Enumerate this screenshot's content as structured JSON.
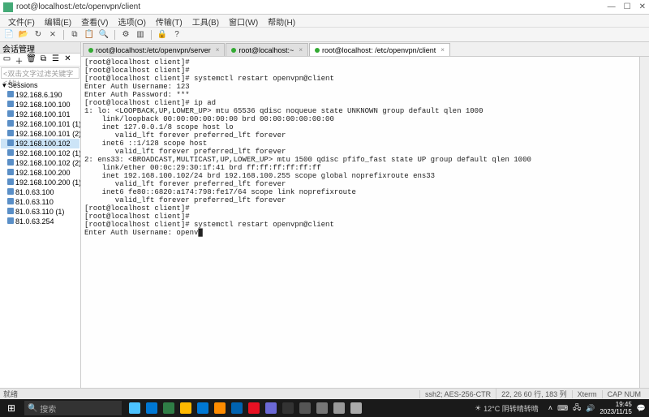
{
  "titlebar": {
    "title": "root@localhost:/etc/openvpn/client"
  },
  "menubar": {
    "items": [
      "文件(F)",
      "编辑(E)",
      "查看(V)",
      "选项(O)",
      "传输(T)",
      "工具(B)",
      "窗口(W)",
      "帮助(H)"
    ]
  },
  "sidebar": {
    "head": "会话管理",
    "filter": "<双击文字过滤关键字<Alt+",
    "rootLabel": "Sessions",
    "items": [
      "192.168.6.190",
      "192.168.100.100",
      "192.168.100.101",
      "192.168.100.101 (1)",
      "192.168.100.101 (2)",
      "192.168.100.102",
      "192.168.100.102 (1)",
      "192.168.100.102 (2)",
      "192.168.100.200",
      "192.168.100.200 (1)",
      "81.0.63.100",
      "81.0.63.110",
      "81.0.63.110 (1)",
      "81.0.63.254"
    ],
    "selectedIndex": 5
  },
  "tabs": {
    "items": [
      {
        "label": "root@localhost:/etc/openvpn/server",
        "active": false
      },
      {
        "label": "root@localhost:~",
        "active": false
      },
      {
        "label": "root@localhost: /etc/openvpn/client",
        "active": true
      }
    ]
  },
  "terminal": {
    "lines": [
      "[root@localhost client]#",
      "[root@localhost client]#",
      "[root@localhost client]# systemctl restart openvpn@client",
      "Enter Auth Username: 123",
      "Enter Auth Password: ***",
      "[root@localhost client]# ip ad",
      "1: lo: <LOOPBACK,UP,LOWER_UP> mtu 65536 qdisc noqueue state UNKNOWN group default qlen 1000",
      "    link/loopback 00:00:00:00:00:00 brd 00:00:00:00:00:00",
      "    inet 127.0.0.1/8 scope host lo",
      "       valid_lft forever preferred_lft forever",
      "    inet6 ::1/128 scope host",
      "       valid_lft forever preferred_lft forever",
      "2: ens33: <BROADCAST,MULTICAST,UP,LOWER_UP> mtu 1500 qdisc pfifo_fast state UP group default qlen 1000",
      "    link/ether 00:0c:29:30:1f:41 brd ff:ff:ff:ff:ff:ff",
      "    inet 192.168.100.102/24 brd 192.168.100.255 scope global noprefixroute ens33",
      "       valid_lft forever preferred_lft forever",
      "    inet6 fe80::6820:a174:798:fe17/64 scope link noprefixroute",
      "       valid_lft forever preferred_lft forever",
      "[root@localhost client]#",
      "[root@localhost client]#",
      "[root@localhost client]# systemctl restart openvpn@client",
      "Enter Auth Username: openv█"
    ]
  },
  "statusbar": {
    "left": "就绪",
    "enc": "ssh2; AES-256-CTR",
    "pos": "22, 26  60 行, 183 列",
    "mode": "Xterm",
    "caps": "CAP  NUM"
  },
  "taskbar": {
    "search": "搜索",
    "weather": "12°C  阴转晴转晴",
    "time": "19:45",
    "date": "2023/11/15",
    "appColors": [
      "#4cc2ff",
      "#0078d4",
      "#2f7d46",
      "#ffb900",
      "#0078d4",
      "#ff8c00",
      "#0063b1",
      "#e81123",
      "#6b69d6",
      "#333",
      "#555",
      "#777",
      "#999",
      "#aaa"
    ]
  }
}
